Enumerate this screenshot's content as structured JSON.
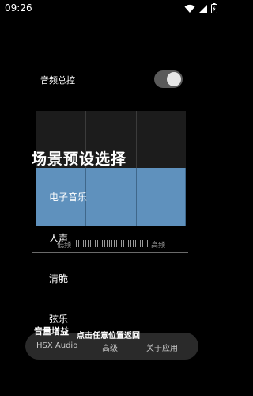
{
  "status_bar": {
    "time": "09:26",
    "icons": [
      "wifi-icon",
      "signal-icon",
      "battery-icon"
    ]
  },
  "master_control": {
    "label": "音频总控",
    "enabled": true
  },
  "dialog": {
    "title": "场景预设选择",
    "options": [
      "电子音乐",
      "人声",
      "清脆",
      "弦乐"
    ],
    "selected": "电子音乐",
    "dismiss_hint": "点击任意位置返回"
  },
  "equalizer": {
    "low_label": "低频",
    "high_label": "高频"
  },
  "gain_label": "音量增益",
  "bottom_nav": {
    "items": [
      "HSX Audio",
      "高级",
      "关于应用"
    ]
  },
  "colors": {
    "background": "#000000",
    "selected_preset": "#5f91bd",
    "nav_background": "#2a2a2a"
  }
}
